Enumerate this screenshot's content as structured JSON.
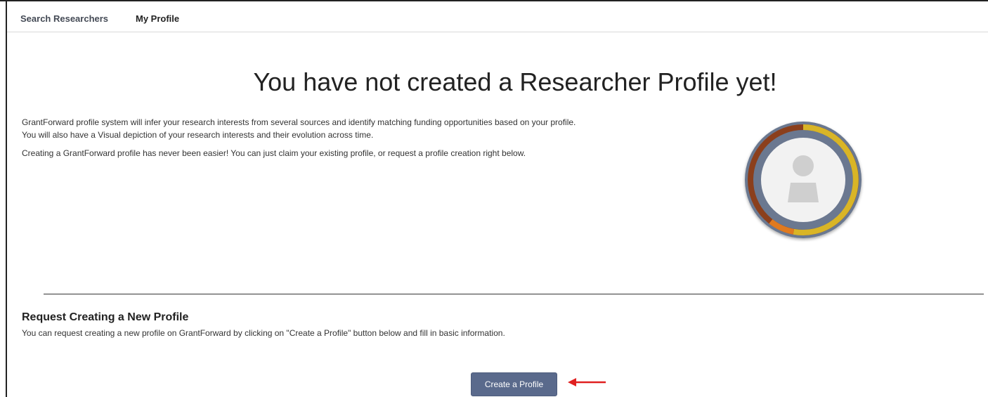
{
  "nav": {
    "tabs": [
      {
        "label": "Search Researchers",
        "active": false
      },
      {
        "label": "My Profile",
        "active": true
      }
    ]
  },
  "main": {
    "title": "You have not created a Researcher Profile yet!",
    "intro": {
      "paragraph_1": "GrantForward profile system will infer your research interests from several sources and identify matching funding opportunities based on your profile. You will also have a Visual depiction of your research interests and their evolution across time.",
      "paragraph_2": "Creating a GrantForward profile has never been easier! You can just claim your existing profile, or request a profile creation right below."
    },
    "illustration": {
      "icon": "user-avatar-ring",
      "colors": {
        "outer_ring": "#6b7890",
        "gold": "#d9b526",
        "brown": "#8b3f1c",
        "orange": "#e07a1f",
        "avatar_bg": "#f2f2f2",
        "person": "#cfcfcf"
      }
    }
  },
  "request_section": {
    "title": "Request Creating a New Profile",
    "description": "You can request creating a new profile on GrantForward by clicking on \"Create a Profile\" button below and fill in basic information.",
    "button_label": "Create a Profile"
  },
  "annotation": {
    "arrow_color": "#e02020"
  },
  "theme": {
    "button_bg": "#5a6a8c"
  }
}
